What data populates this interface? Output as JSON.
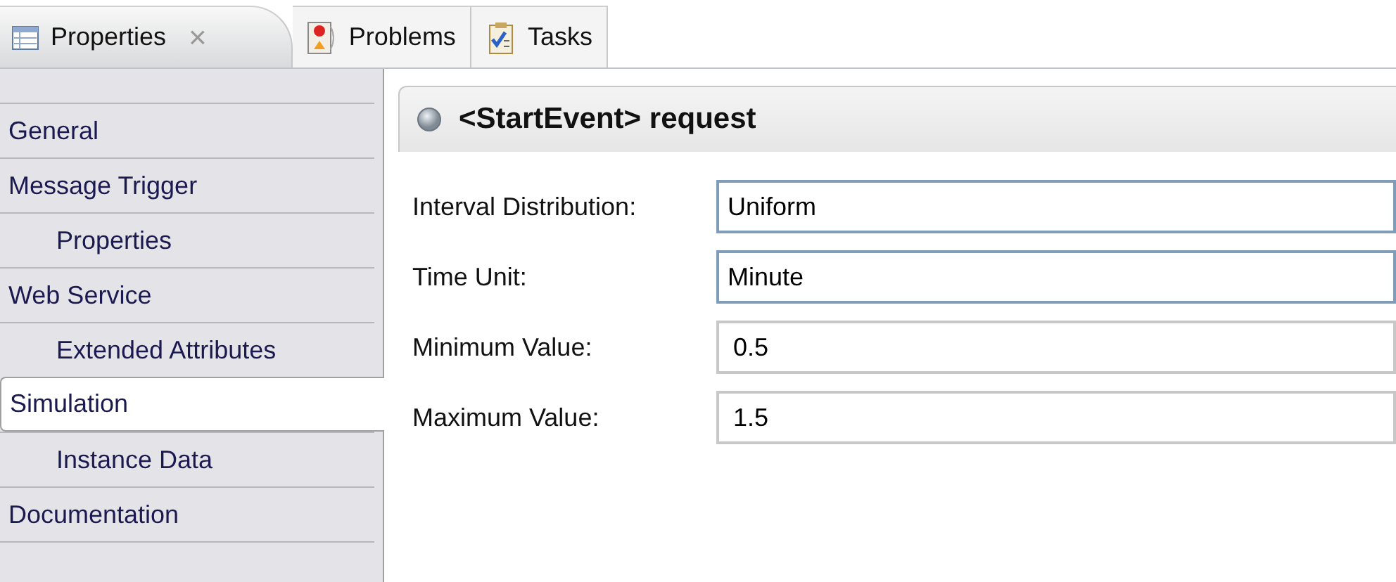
{
  "tabs": [
    {
      "label": "Properties",
      "kind": "table",
      "selected": true,
      "close": "×"
    },
    {
      "label": "Problems",
      "kind": "problems",
      "selected": false
    },
    {
      "label": "Tasks",
      "kind": "tasks",
      "selected": false
    }
  ],
  "sidebar": {
    "items": [
      {
        "label": "General",
        "selected": false
      },
      {
        "label": "Message Trigger",
        "selected": false,
        "children": [
          {
            "label": "Properties",
            "selected": false
          }
        ]
      },
      {
        "label": "Web Service",
        "selected": false,
        "children": [
          {
            "label": "Extended Attributes",
            "selected": false
          }
        ]
      },
      {
        "label": "Simulation",
        "selected": true,
        "children": [
          {
            "label": "Instance Data",
            "selected": false
          }
        ]
      },
      {
        "label": "Documentation",
        "selected": false
      }
    ]
  },
  "header": {
    "title": "<StartEvent> request"
  },
  "fields": [
    {
      "label": "Interval Distribution:",
      "value": "Uniform",
      "kind": "combo"
    },
    {
      "label": "Time Unit:",
      "value": "Minute",
      "kind": "combo"
    },
    {
      "label": "Minimum Value:",
      "value": "0.5",
      "kind": "text"
    },
    {
      "label": "Maximum Value:",
      "value": "1.5",
      "kind": "text"
    }
  ]
}
